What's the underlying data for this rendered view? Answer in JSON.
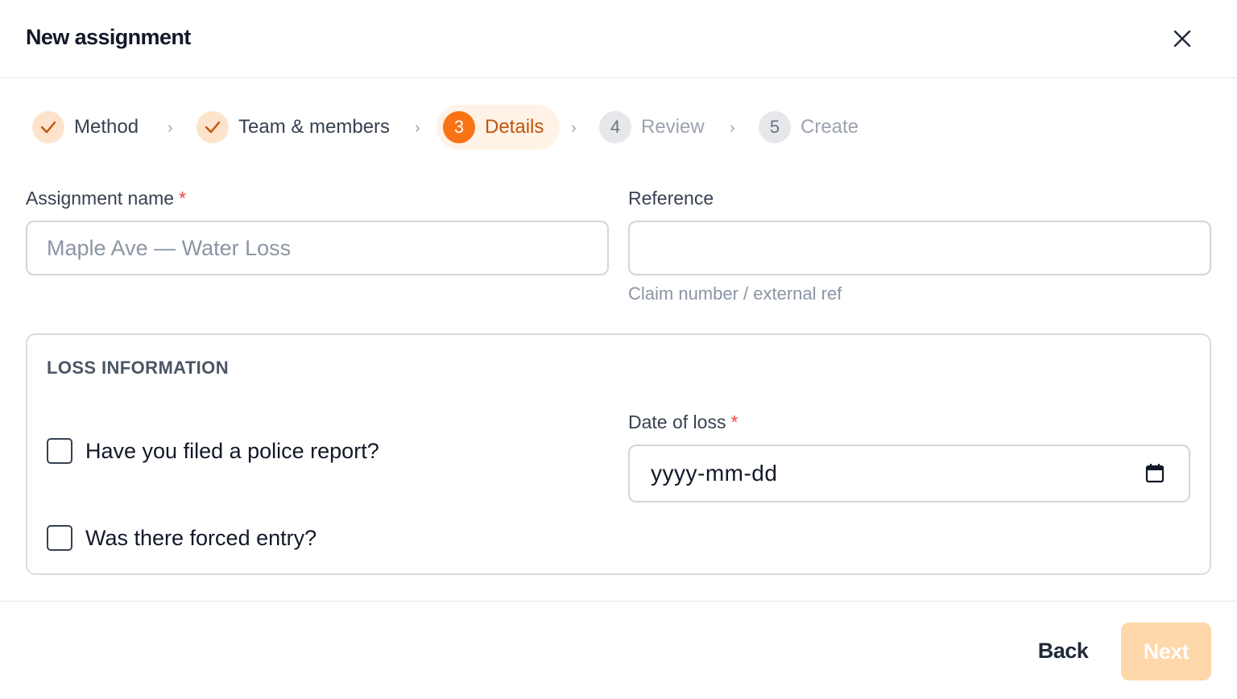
{
  "dialog": {
    "title": "New assignment",
    "close_icon": "close-icon"
  },
  "stepper": {
    "steps": [
      {
        "number": "1",
        "label": "Method",
        "state": "done"
      },
      {
        "number": "2",
        "label": "Team & members",
        "state": "done"
      },
      {
        "number": "3",
        "label": "Details",
        "state": "active"
      },
      {
        "number": "4",
        "label": "Review",
        "state": "pending"
      },
      {
        "number": "5",
        "label": "Create",
        "state": "pending"
      }
    ],
    "separator": "›"
  },
  "form": {
    "assignment_name": {
      "label": "Assignment name",
      "required_mark": "*",
      "placeholder": "Maple Ave — Water Loss",
      "value": ""
    },
    "reference": {
      "label": "Reference",
      "placeholder": "",
      "value": "",
      "hint": "Claim number / external ref"
    },
    "loss_information": {
      "title": "LOSS INFORMATION",
      "police_report": {
        "label": "Have you filed a police report?",
        "checked": false
      },
      "forced_entry": {
        "label": "Was there forced entry?",
        "checked": false
      },
      "date_of_loss": {
        "label": "Date of loss",
        "required_mark": "*",
        "placeholder": "yyyy-mm-dd",
        "icon": "calendar-icon"
      }
    }
  },
  "footer": {
    "back_label": "Back",
    "next_label": "Next",
    "next_enabled": false
  },
  "colors": {
    "accent": "#f97316",
    "accent_light": "#fde3cb",
    "active_step_bg": "#fff2e6",
    "next_disabled": "#fed7aa",
    "required": "#ef4444"
  }
}
